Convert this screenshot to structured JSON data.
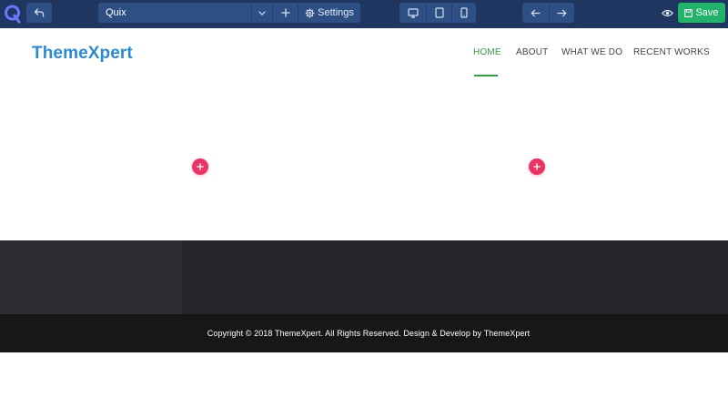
{
  "toolbar": {
    "logo_icon": "quix-logo-icon",
    "page_name": "Quix",
    "settings_label": "Settings",
    "save_label": "Save",
    "colors": {
      "bar": "#1f3760",
      "button": "#2e4f84",
      "save": "#22b36a"
    }
  },
  "site": {
    "brand": "ThemeXpert",
    "nav": [
      "HOME",
      "ABOUT",
      "WHAT WE DO",
      "RECENT WORKS"
    ],
    "active_nav": "HOME",
    "colors": {
      "brand": "#2b8ad0",
      "active": "#3a9a46",
      "add": "#e83465"
    }
  },
  "footer": {
    "copyright": "Copyright © 2018 ThemeXpert. All Rights Reserved. Design & Develop by ThemeXpert"
  }
}
